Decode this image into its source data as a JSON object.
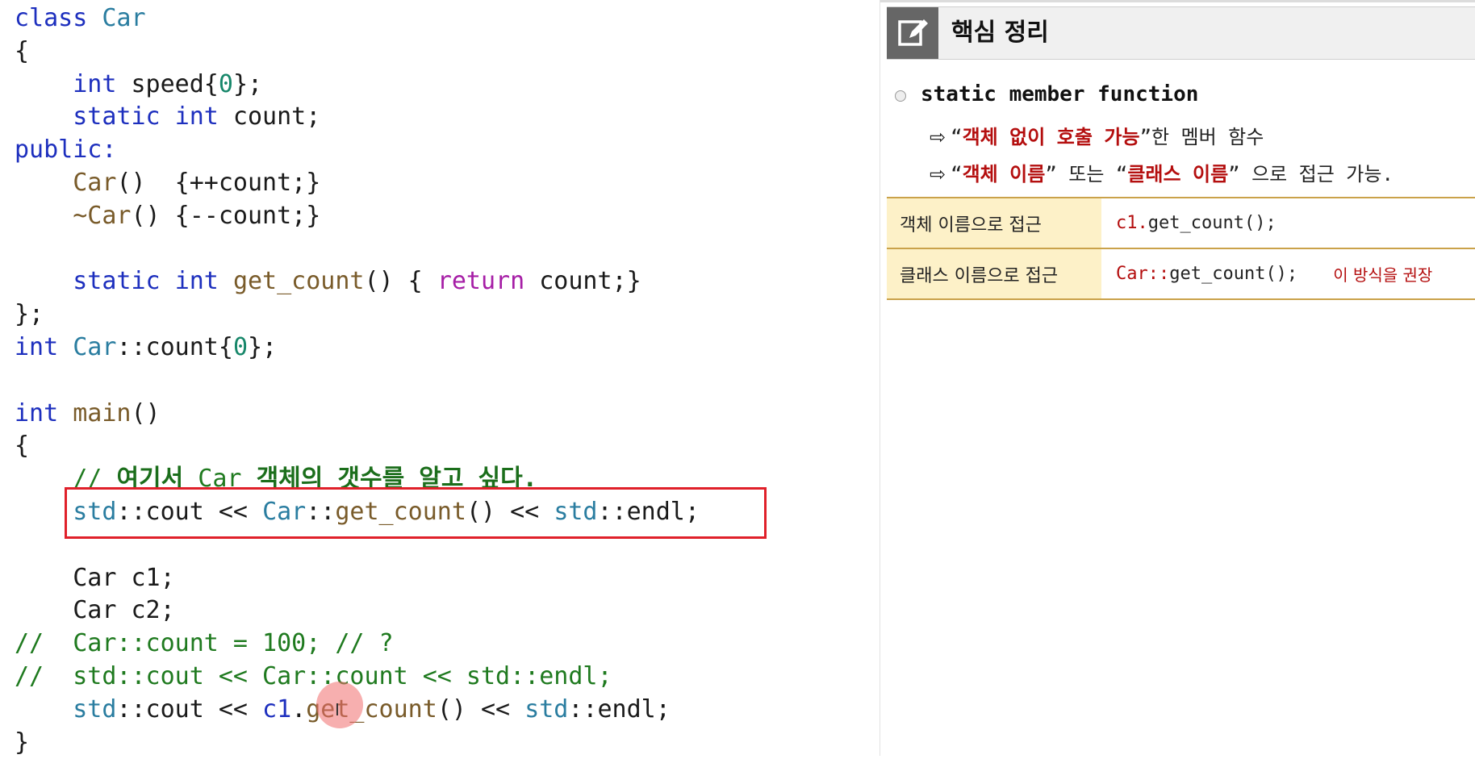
{
  "editor": {
    "lines": [
      {
        "segments": [
          {
            "t": "class",
            "c": "kw"
          },
          {
            "t": " "
          },
          {
            "t": "Car",
            "c": "ty"
          }
        ]
      },
      {
        "segments": [
          {
            "t": "{"
          }
        ]
      },
      {
        "segments": [
          {
            "t": "    "
          },
          {
            "t": "int",
            "c": "kw"
          },
          {
            "t": " speed{"
          },
          {
            "t": "0",
            "c": "num"
          },
          {
            "t": "};"
          }
        ]
      },
      {
        "segments": [
          {
            "t": "    "
          },
          {
            "t": "static",
            "c": "kw"
          },
          {
            "t": " "
          },
          {
            "t": "int",
            "c": "kw"
          },
          {
            "t": " count;"
          }
        ]
      },
      {
        "segments": [
          {
            "t": "public:",
            "c": "kw"
          }
        ]
      },
      {
        "segments": [
          {
            "t": "    "
          },
          {
            "t": "Car",
            "c": "fn"
          },
          {
            "t": "()  {++count;}"
          }
        ]
      },
      {
        "segments": [
          {
            "t": "    "
          },
          {
            "t": "~Car",
            "c": "fn"
          },
          {
            "t": "() {--count;}"
          }
        ]
      },
      {
        "segments": []
      },
      {
        "segments": [
          {
            "t": "    "
          },
          {
            "t": "static",
            "c": "kw"
          },
          {
            "t": " "
          },
          {
            "t": "int",
            "c": "kw"
          },
          {
            "t": " "
          },
          {
            "t": "get_count",
            "c": "fn"
          },
          {
            "t": "() { "
          },
          {
            "t": "return",
            "c": "ret"
          },
          {
            "t": " count;}"
          }
        ]
      },
      {
        "segments": [
          {
            "t": "};"
          }
        ]
      },
      {
        "segments": [
          {
            "t": "int",
            "c": "kw"
          },
          {
            "t": " "
          },
          {
            "t": "Car",
            "c": "ty"
          },
          {
            "t": "::count{"
          },
          {
            "t": "0",
            "c": "num"
          },
          {
            "t": "};"
          }
        ]
      },
      {
        "segments": []
      },
      {
        "segments": [
          {
            "t": "int",
            "c": "kw"
          },
          {
            "t": " "
          },
          {
            "t": "main",
            "c": "fn"
          },
          {
            "t": "()"
          }
        ]
      },
      {
        "segments": [
          {
            "t": "{"
          }
        ]
      },
      {
        "segments": [
          {
            "t": "    // ",
            "c": "cm"
          },
          {
            "t": "여기서",
            "c": "cmb"
          },
          {
            "t": " Car ",
            "c": "cm"
          },
          {
            "t": "객체의 갯수를 알고 싶다.",
            "c": "cmb"
          }
        ]
      },
      {
        "segments": [
          {
            "t": "    "
          },
          {
            "t": "std",
            "c": "ty"
          },
          {
            "t": "::cout << "
          },
          {
            "t": "Car",
            "c": "ty"
          },
          {
            "t": "::"
          },
          {
            "t": "get_count",
            "c": "fn"
          },
          {
            "t": "() << "
          },
          {
            "t": "std",
            "c": "ty"
          },
          {
            "t": "::endl;"
          }
        ]
      },
      {
        "segments": []
      },
      {
        "segments": [
          {
            "t": "    Car c1;"
          }
        ]
      },
      {
        "segments": [
          {
            "t": "    Car c2;"
          }
        ]
      },
      {
        "segments": [
          {
            "t": "//  Car::count = 100; // ?",
            "c": "cm"
          }
        ]
      },
      {
        "segments": [
          {
            "t": "//  std::cout << Car::count << std::endl;",
            "c": "cm"
          }
        ]
      },
      {
        "segments": [
          {
            "t": "    "
          },
          {
            "t": "std",
            "c": "ty"
          },
          {
            "t": "::cout << "
          },
          {
            "t": "c1",
            "c": "kw"
          },
          {
            "t": "."
          },
          {
            "t": "get_count",
            "c": "fn"
          },
          {
            "t": "() << "
          },
          {
            "t": "std",
            "c": "ty"
          },
          {
            "t": "::endl;"
          }
        ]
      },
      {
        "segments": [
          {
            "t": "}"
          }
        ]
      }
    ]
  },
  "panel": {
    "header": {
      "icon": "edit-note-icon",
      "title": "핵심 정리"
    },
    "heading": "static member function",
    "desc1": {
      "arrow": "⇨",
      "q1": "“",
      "em": "객체 없이 호출 가능",
      "rest": "”한 멤버 함수"
    },
    "desc2": {
      "arrow": "⇨",
      "q1": "“",
      "em1": "객체 이름",
      "mid": "” 또는 “",
      "em2": "클래스 이름",
      "rest": "” 으로 접근 가능."
    },
    "table": [
      {
        "label": "객체 이름으로 접근",
        "code_red": "c1.",
        "code": "get_count();",
        "note": ""
      },
      {
        "label": "클래스 이름으로 접근",
        "code_red": "Car::",
        "code": "get_count();",
        "note": "이 방식을 권장"
      }
    ],
    "colors": {
      "accent_red": "#b40e0e",
      "table_border": "#caa24a",
      "table_label_bg": "#fdf1c8"
    }
  }
}
